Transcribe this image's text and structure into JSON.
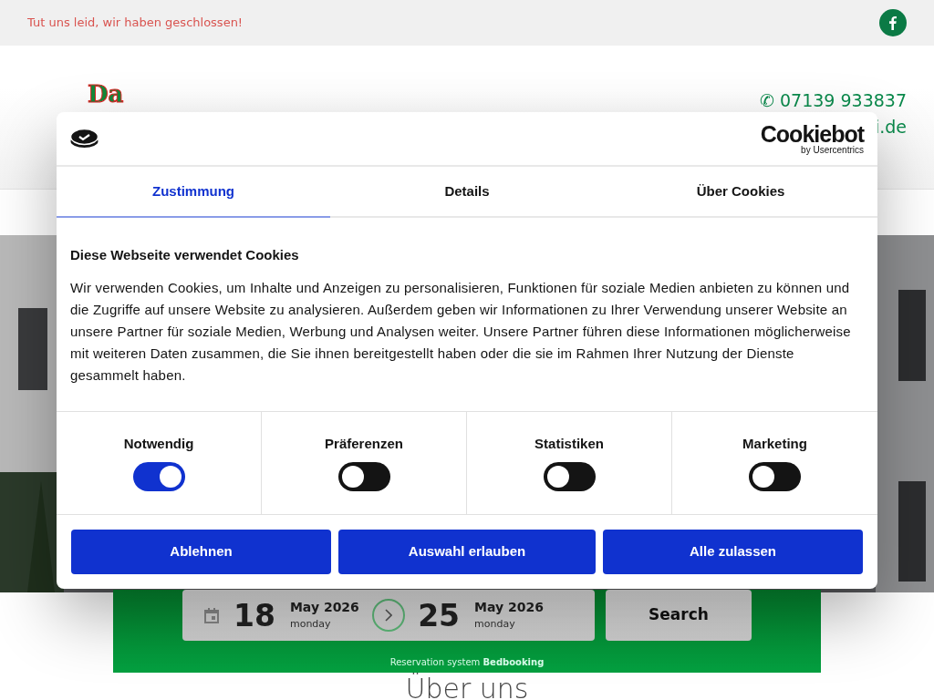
{
  "topbar": {
    "notice": "Tut uns leid, wir haben geschlossen!",
    "social": [
      {
        "kind": "facebook"
      }
    ]
  },
  "header": {
    "logo_text": "Da",
    "phone_icon": "✆",
    "phone": "07139 933837",
    "email_fragment": "i.de"
  },
  "booking": {
    "arrival": {
      "day": "18",
      "month": "May 2026",
      "weekday": "monday"
    },
    "departure": {
      "day": "25",
      "month": "May 2026",
      "weekday": "monday"
    },
    "search_button": "Search",
    "footer": "Reservation system **Bedbooking**"
  },
  "section_heading": "Über uns",
  "cookie_dialog": {
    "brand": "Cookiebot",
    "brand_sub": "by Usercentrics",
    "tabs": [
      {
        "label": "Zustimmung",
        "selected": true
      },
      {
        "label": "Details",
        "selected": false
      },
      {
        "label": "Über Cookies",
        "selected": false
      }
    ],
    "title": "Diese Webseite verwendet Cookies",
    "text": "Wir verwenden Cookies, um Inhalte und Anzeigen zu personalisieren, Funktionen für soziale Medien anbieten zu können und die Zugriffe auf unsere Website zu analysieren. Außerdem geben wir Informationen zu Ihrer Verwendung unserer Website an unsere Partner für soziale Medien, Werbung und Analysen weiter. Unsere Partner führen diese Informationen möglicherweise mit weiteren Daten zusammen, die Sie ihnen bereitgestellt haben oder die sie im Rahmen Ihrer Nutzung der Dienste gesammelt haben.",
    "categories": [
      {
        "label": "Notwendig",
        "checked": true
      },
      {
        "label": "Präferenzen",
        "checked": false
      },
      {
        "label": "Statistiken",
        "checked": false
      },
      {
        "label": "Marketing",
        "checked": false
      }
    ],
    "buttons": [
      "Ablehnen",
      "Auswahl erlauben",
      "Alle zulassen"
    ]
  }
}
